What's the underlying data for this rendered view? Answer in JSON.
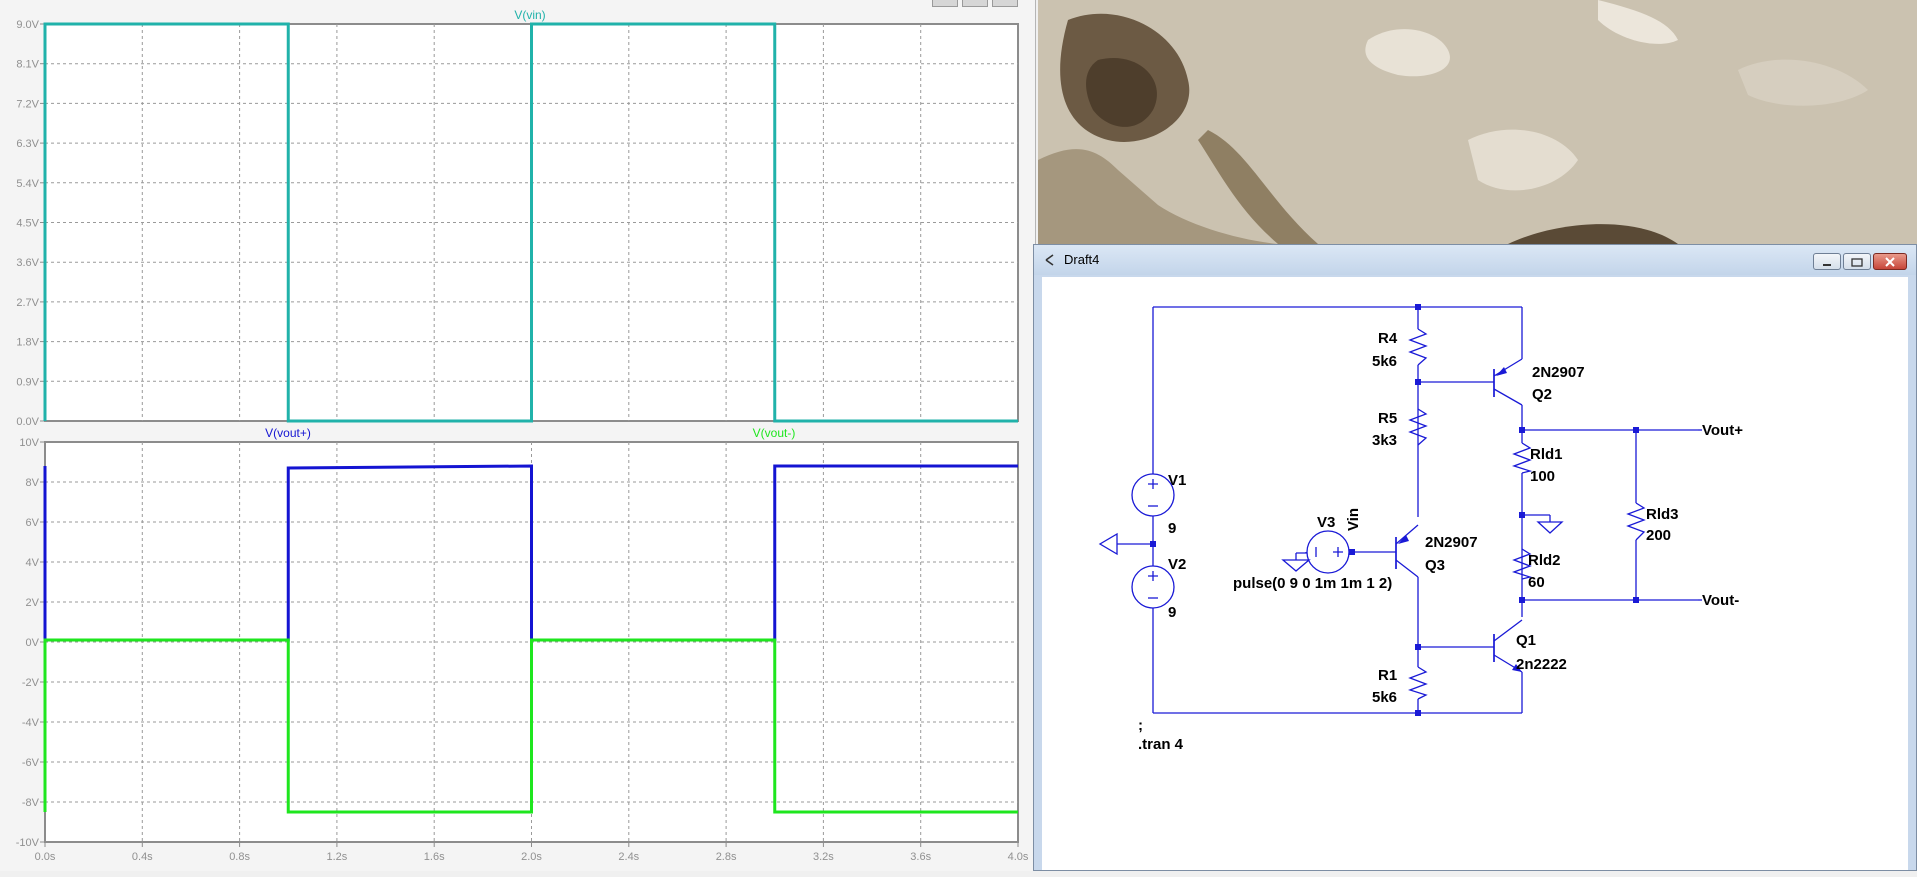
{
  "waveform_viewer": {
    "top_pane": {
      "trace_label": "V(vin)",
      "trace_color": "#20b2aa",
      "y_ticks": [
        "9.0V",
        "8.1V",
        "7.2V",
        "6.3V",
        "5.4V",
        "4.5V",
        "3.6V",
        "2.7V",
        "1.8V",
        "0.9V",
        "0.0V"
      ]
    },
    "bottom_pane": {
      "trace_labels": [
        "V(vout+)",
        "V(vout-)"
      ],
      "trace_colors": [
        "#1414d2",
        "#1ee61e"
      ],
      "y_ticks": [
        "10V",
        "8V",
        "6V",
        "4V",
        "2V",
        "0V",
        "-2V",
        "-4V",
        "-6V",
        "-8V",
        "-10V"
      ]
    },
    "x_ticks": [
      "0.0s",
      "0.4s",
      "0.8s",
      "1.2s",
      "1.6s",
      "2.0s",
      "2.4s",
      "2.8s",
      "3.2s",
      "3.6s",
      "4.0s"
    ]
  },
  "chart_data": [
    {
      "type": "line",
      "title": "V(vin)",
      "x_unit": "s",
      "xlim": [
        0,
        4
      ],
      "ylim": [
        0,
        9
      ],
      "series": [
        {
          "name": "V(vin)",
          "x": [
            0,
            0,
            1,
            1,
            2,
            2,
            3,
            3,
            4
          ],
          "values": [
            0,
            9,
            9,
            0,
            0,
            9,
            9,
            0,
            0
          ]
        }
      ],
      "grid": true
    },
    {
      "type": "line",
      "title": "",
      "x_unit": "s",
      "xlim": [
        0,
        4
      ],
      "ylim": [
        -10,
        10
      ],
      "series": [
        {
          "name": "V(vout+)",
          "x": [
            0,
            0,
            1,
            1,
            2,
            2,
            3,
            3,
            4
          ],
          "values": [
            8.8,
            0.1,
            0.1,
            8.7,
            8.8,
            0.1,
            0.1,
            8.8,
            8.8
          ]
        },
        {
          "name": "V(vout-)",
          "x": [
            0,
            0,
            1,
            1,
            2,
            2,
            3,
            3,
            4
          ],
          "values": [
            -8.5,
            0.1,
            0.1,
            -8.5,
            -8.5,
            0.1,
            0.1,
            -8.5,
            -8.5
          ]
        }
      ],
      "grid": true
    }
  ],
  "schematic_window": {
    "title": "Draft4",
    "components": {
      "r4": {
        "name": "R4",
        "value": "5k6"
      },
      "r5": {
        "name": "R5",
        "value": "3k3"
      },
      "r1": {
        "name": "R1",
        "value": "5k6"
      },
      "rld1": {
        "name": "Rld1",
        "value": "100"
      },
      "rld2": {
        "name": "Rld2",
        "value": "60"
      },
      "rld3": {
        "name": "Rld3",
        "value": "200"
      },
      "q2": {
        "name": "Q2",
        "model": "2N2907"
      },
      "q3": {
        "name": "Q3",
        "model": "2N2907"
      },
      "q1": {
        "name": "Q1",
        "model": "2n2222"
      },
      "v1": {
        "name": "V1",
        "value": "9"
      },
      "v2": {
        "name": "V2",
        "value": "9"
      },
      "v3": {
        "name": "V3",
        "value": "pulse(0 9 0 1m 1m 1 2)"
      }
    },
    "net_labels": {
      "vout_plus": "Vout+",
      "vout_minus": "Vout-",
      "vin": "Vin"
    },
    "directives": [
      ";",
      ".tran 4"
    ],
    "wire_color": "#1a1ad6"
  }
}
